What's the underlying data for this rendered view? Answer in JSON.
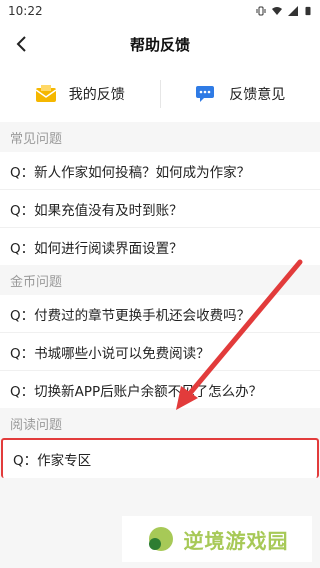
{
  "status_bar": {
    "time": "10:22"
  },
  "header": {
    "title": "帮助反馈"
  },
  "tabs": [
    {
      "label": "我的反馈",
      "icon": "mail-icon"
    },
    {
      "label": "反馈意见",
      "icon": "chat-icon"
    }
  ],
  "sections": [
    {
      "title": "常见问题",
      "items": [
        "Q：新人作家如何投稿？如何成为作家？",
        "Q：如果充值没有及时到账？",
        "Q：如何进行阅读界面设置？"
      ]
    },
    {
      "title": "金币问题",
      "items": [
        "Q：付费过的章节更换手机还会收费吗？",
        "Q：书城哪些小说可以免费阅读？",
        "Q：切换新APP后账户余额不见了怎么办？"
      ]
    },
    {
      "title": "阅读问题",
      "items": [
        "Q：作家专区"
      ]
    }
  ],
  "watermark": {
    "text": "逆境游戏园"
  },
  "colors": {
    "accent_red": "#e23b3b",
    "watermark_green": "#a7c957",
    "mail_yellow": "#f5b700",
    "chat_blue": "#2f7be5"
  }
}
